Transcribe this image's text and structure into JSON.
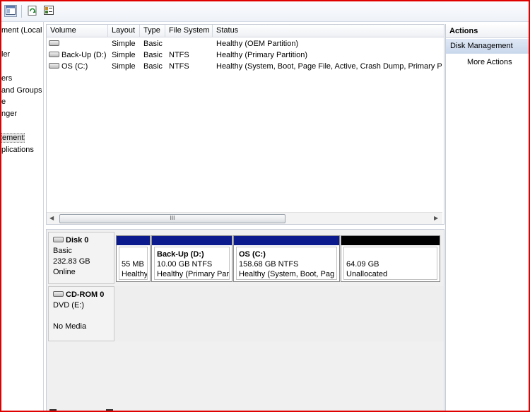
{
  "tree": {
    "items": [
      "ment (Local",
      "ler",
      "ers",
      "and Groups",
      "e",
      "nger",
      "ement",
      "plications"
    ],
    "selected_index": 6
  },
  "list": {
    "columns": [
      "Volume",
      "Layout",
      "Type",
      "File System",
      "Status"
    ],
    "rows": [
      {
        "volume": "",
        "layout": "Simple",
        "type": "Basic",
        "fs": "",
        "status": "Healthy (OEM Partition)"
      },
      {
        "volume": "Back-Up (D:)",
        "layout": "Simple",
        "type": "Basic",
        "fs": "NTFS",
        "status": "Healthy (Primary Partition)"
      },
      {
        "volume": "OS (C:)",
        "layout": "Simple",
        "type": "Basic",
        "fs": "NTFS",
        "status": "Healthy (System, Boot, Page File, Active, Crash Dump, Primary P"
      }
    ],
    "scroll_thumb_label": "III"
  },
  "disks": [
    {
      "name": "Disk 0",
      "lines": [
        "Basic",
        "232.83 GB",
        "Online"
      ],
      "partitions": [
        {
          "title": "",
          "size": "55 MB",
          "status": "Healthy"
        },
        {
          "title": "Back-Up  (D:)",
          "size": "10.00 GB NTFS",
          "status": "Healthy (Primary Par"
        },
        {
          "title": "OS  (C:)",
          "size": "158.68 GB NTFS",
          "status": "Healthy (System, Boot, Pag"
        },
        {
          "title": "",
          "size": "64.09 GB",
          "status": "Unallocated"
        }
      ]
    },
    {
      "name": "CD-ROM 0",
      "lines": [
        "DVD (E:)",
        "",
        "No Media"
      ]
    }
  ],
  "actions": {
    "title": "Actions",
    "section": "Disk Management",
    "items": [
      "More Actions"
    ]
  },
  "colors": {
    "partition_bar": "#0b1a8c",
    "unallocated_bar": "#000000",
    "frame_border": "#e00000"
  }
}
